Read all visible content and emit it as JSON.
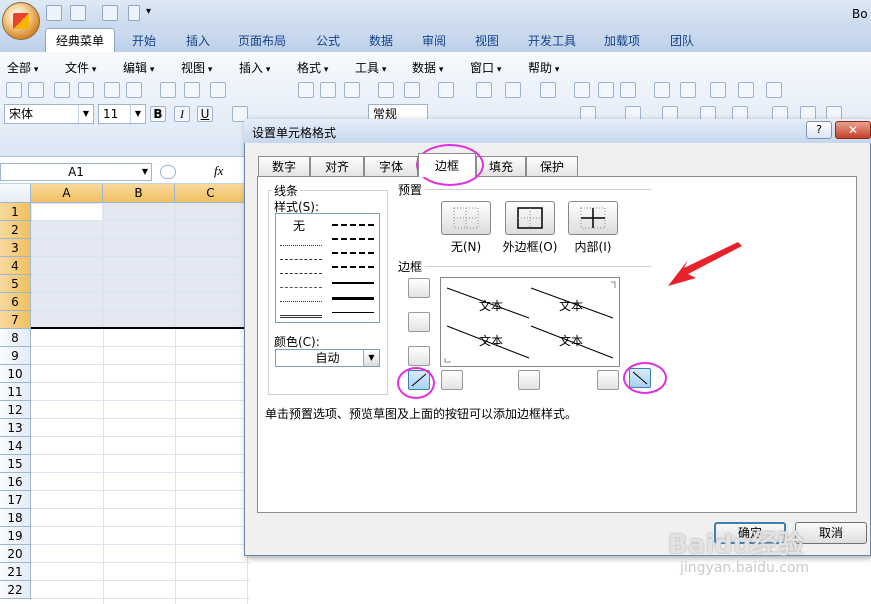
{
  "window": {
    "title_fragment": "Bo"
  },
  "ribbon": {
    "tabs": [
      "经典菜单",
      "开始",
      "插入",
      "页面布局",
      "公式",
      "数据",
      "审阅",
      "视图",
      "开发工具",
      "加载项",
      "团队"
    ],
    "active_tab": "经典菜单"
  },
  "classic_menu": {
    "items": [
      "全部",
      "文件",
      "编辑",
      "视图",
      "插入",
      "格式",
      "工具",
      "数据",
      "窗口",
      "帮助"
    ]
  },
  "font_bar": {
    "font_name": "宋体",
    "font_size": "11",
    "bold": "B",
    "italic": "I",
    "underline": "U",
    "number_format": "常规"
  },
  "formula_bar": {
    "name_box": "A1",
    "fx": "fx"
  },
  "sheet": {
    "columns": [
      "A",
      "B",
      "C"
    ],
    "rows": [
      "1",
      "2",
      "3",
      "4",
      "5",
      "6",
      "7",
      "8",
      "9",
      "10",
      "11",
      "12",
      "13",
      "14",
      "15",
      "16",
      "17",
      "18",
      "19",
      "20",
      "21",
      "22"
    ],
    "selected_rows": 7
  },
  "dialog": {
    "title": "设置单元格格式",
    "help": "?",
    "close": "✕",
    "tabs": [
      "数字",
      "对齐",
      "字体",
      "边框",
      "填充",
      "保护"
    ],
    "active_tab": "边框",
    "line": {
      "section_label": "线条",
      "style_label": "样式(S):",
      "none_label": "无",
      "color_label": "颜色(C):",
      "color_value": "自动"
    },
    "presets": {
      "section_label": "预置",
      "items": [
        {
          "label": "无(N)"
        },
        {
          "label": "外边框(O)"
        },
        {
          "label": "内部(I)"
        }
      ]
    },
    "border": {
      "section_label": "边框",
      "preview_text": [
        "文本",
        "文本",
        "文本",
        "文本"
      ]
    },
    "hint": "单击预置选项、预览草图及上面的按钮可以添加边框样式。",
    "ok": "确定",
    "cancel": "取消"
  },
  "watermark": {
    "main": "Baidu经验",
    "sub": "jingyan.baidu.com"
  },
  "colors": {
    "annotation": "#e030e0",
    "arrow": "#e8222b",
    "selection": "#e3e8f3",
    "ribbon_blue": "#15428b"
  }
}
